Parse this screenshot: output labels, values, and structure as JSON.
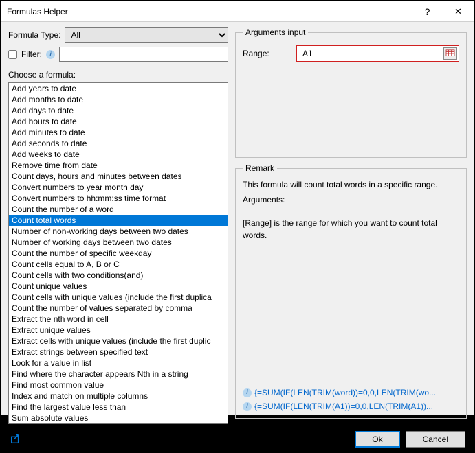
{
  "window": {
    "title": "Formulas Helper",
    "help": "?",
    "close": "✕"
  },
  "left": {
    "formulaTypeLabel": "Formula Type:",
    "formulaTypeValue": "All",
    "filterLabel": "Filter:",
    "filterValue": "",
    "chooseLabel": "Choose a formula:",
    "items": [
      "Add years to date",
      "Add months to date",
      "Add days to date",
      "Add hours to date",
      "Add minutes to date",
      "Add seconds to date",
      "Add weeks to date",
      "Remove time from date",
      "Count days, hours and minutes between dates",
      "Convert numbers to year month day",
      "Convert numbers to hh:mm:ss time format",
      "Count the number of a word",
      "Count total words",
      "Number of non-working days between two dates",
      "Number of working days between two dates",
      "Count the number of specific weekday",
      "Count cells equal to A, B or C",
      "Count cells with two conditions(and)",
      "Count unique values",
      "Count cells with unique values (include the first duplica",
      "Count the number of values separated by comma",
      "Extract the nth word in cell",
      "Extract unique values",
      "Extract cells with unique values (include the first duplic",
      "Extract strings between specified text",
      "Look for a value in list",
      "Find where the character appears Nth in a string",
      "Find most common value",
      "Index and match on multiple columns",
      "Find the largest value less than",
      "Sum absolute values"
    ],
    "selectedIndex": 12
  },
  "right": {
    "argsLegend": "Arguments input",
    "rangeLabel": "Range:",
    "rangeValue": "A1",
    "remarkLegend": "Remark",
    "remarkLine1": "This formula will count total words in a specific range.",
    "remarkLine2": "Arguments:",
    "remarkLine3": "[Range] is the range for which you want to count total words.",
    "formulaLink1": "{=SUM(IF(LEN(TRIM(word))=0,0,LEN(TRIM(wo...",
    "formulaLink2": "{=SUM(IF(LEN(TRIM(A1))=0,0,LEN(TRIM(A1))..."
  },
  "footer": {
    "ok": "Ok",
    "cancel": "Cancel"
  }
}
